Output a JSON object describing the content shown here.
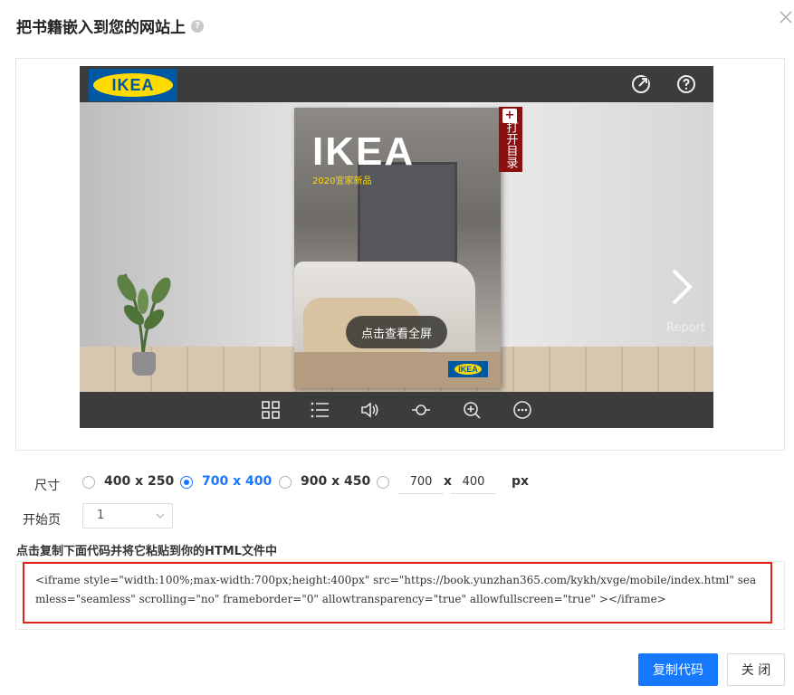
{
  "dialog": {
    "title": "把书籍嵌入到您的网站上",
    "help_icon": "question-circle-icon",
    "close_icon": "close-icon"
  },
  "preview": {
    "logo_text": "IKEA",
    "top_icons": [
      "share-icon",
      "help-icon"
    ],
    "book": {
      "brand": "IKEA",
      "subtitle": "2020宜家新品",
      "small_logo": "IKEA"
    },
    "toc_tab": "打开目录",
    "fullscreen_label": "点击查看全屏",
    "report_label": "Report",
    "bottom_icons": [
      "thumbnails-icon",
      "list-icon",
      "sound-icon",
      "autoplay-icon",
      "zoom-in-icon",
      "more-icon"
    ],
    "accent_colors": {
      "ikea_blue": "#0058a3",
      "ikea_yellow": "#ffdb00",
      "toc_red": "#8b1010"
    }
  },
  "size": {
    "label": "尺寸",
    "options": [
      {
        "label": "400 x 250",
        "checked": false
      },
      {
        "label": "700 x 400",
        "checked": true
      },
      {
        "label": "900 x 450",
        "checked": false
      }
    ],
    "custom_width": "700",
    "custom_height": "400",
    "x_label": "x",
    "unit": "px"
  },
  "start_page": {
    "label": "开始页",
    "value": "1"
  },
  "code": {
    "label": "点击复制下面代码并将它粘贴到你的HTML文件中",
    "snippet": "<iframe style=\"width:100%;max-width:700px;height:400px\" src=\"https://book.yunzhan365.com/kykh/xvge/mobile/index.html\"  seamless=\"seamless\" scrolling=\"no\" frameborder=\"0\" allowtransparency=\"true\" allowfullscreen=\"true\" ></iframe>"
  },
  "buttons": {
    "copy": "复制代码",
    "close": "关 闭"
  },
  "colors": {
    "primary": "#1677ff",
    "code_border": "#e2231a"
  }
}
